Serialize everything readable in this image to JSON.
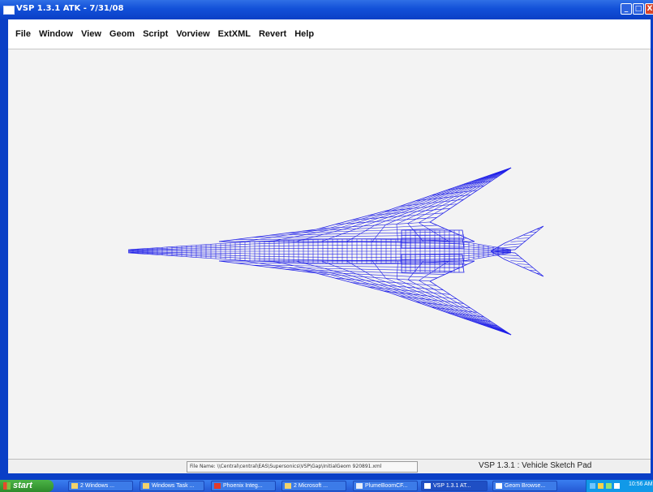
{
  "window": {
    "title": "VSP 1.3.1 ATK - 7/31/08",
    "controls": {
      "minimize": "_",
      "maximize": "□",
      "close": "X"
    }
  },
  "menu": {
    "items": [
      "File",
      "Window",
      "View",
      "Geom",
      "Script",
      "Vorview",
      "ExtXML",
      "Revert",
      "Help"
    ]
  },
  "viewport": {
    "model": "aircraft-wireframe",
    "wire_color": "#1f1fe8"
  },
  "status": {
    "file_name": "File Name: \\\\Central\\central\\EAS\\Supersonics\\VSP\\Gap\\InitialGeom 920891.xml",
    "app_name": "VSP 1.3.1 : Vehicle Sketch Pad"
  },
  "taskbar": {
    "start_label": "start",
    "tasks": [
      {
        "label": "2 Windows ...",
        "active": false
      },
      {
        "label": "Windows Task ...",
        "active": false
      },
      {
        "label": "Phoenix Integ...",
        "active": false
      },
      {
        "label": "2 Microsoft ...",
        "active": false
      },
      {
        "label": "PlumeBoomCF...",
        "active": false
      },
      {
        "label": "VSP 1.3.1 AT...",
        "active": true
      },
      {
        "label": "Geom Browse...",
        "active": false
      }
    ],
    "clock": "10:56 AM"
  }
}
